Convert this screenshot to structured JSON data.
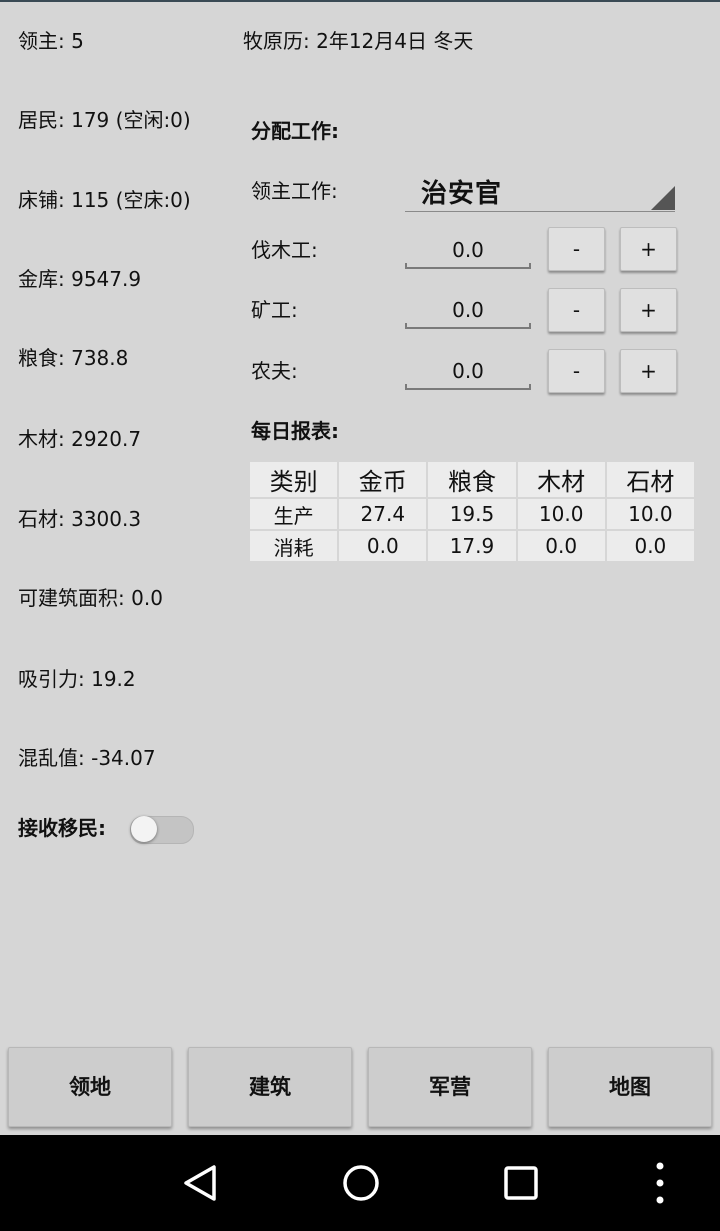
{
  "status": {
    "lord": {
      "label": "领主:",
      "value": "5"
    },
    "residents": {
      "label": "居民:",
      "value": "179 (空闲:0)"
    },
    "beds": {
      "label": "床铺:",
      "value": "115 (空床:0)"
    },
    "treasury": {
      "label": "金库:",
      "value": "9547.9"
    },
    "food": {
      "label": "粮食:",
      "value": "738.8"
    },
    "wood": {
      "label": "木材:",
      "value": "2920.7"
    },
    "stone": {
      "label": "石材:",
      "value": "3300.3"
    },
    "buildable_area": {
      "label": "可建筑面积:",
      "value": "0.0"
    },
    "attraction": {
      "label": "吸引力:",
      "value": "19.2"
    },
    "chaos": {
      "label": "混乱值:",
      "value": "-34.07"
    }
  },
  "calendar": "牧原历: 2年12月4日  冬天",
  "work": {
    "title": "分配工作:",
    "lord_job_label": "领主工作:",
    "lord_job_value": "治安官",
    "rows": [
      {
        "label": "伐木工:",
        "value": "0.0",
        "minus": "-",
        "plus": "+"
      },
      {
        "label": "矿工:",
        "value": "0.0",
        "minus": "-",
        "plus": "+"
      },
      {
        "label": "农夫:",
        "value": "0.0",
        "minus": "-",
        "plus": "+"
      }
    ]
  },
  "report": {
    "title": "每日报表:",
    "headers": [
      "类别",
      "金币",
      "粮食",
      "木材",
      "石材"
    ],
    "rows": [
      [
        "生产",
        "27.4",
        "19.5",
        "10.0",
        "10.0"
      ],
      [
        "消耗",
        "0.0",
        "17.9",
        "0.0",
        "0.0"
      ]
    ]
  },
  "immigration": {
    "label": "接收移民:",
    "enabled": false
  },
  "tabs": [
    "领地",
    "建筑",
    "军营",
    "地图"
  ],
  "navbar": {
    "icons": [
      "back-triangle-icon",
      "home-circle-icon",
      "recents-square-icon",
      "overflow-menu-icon"
    ]
  }
}
